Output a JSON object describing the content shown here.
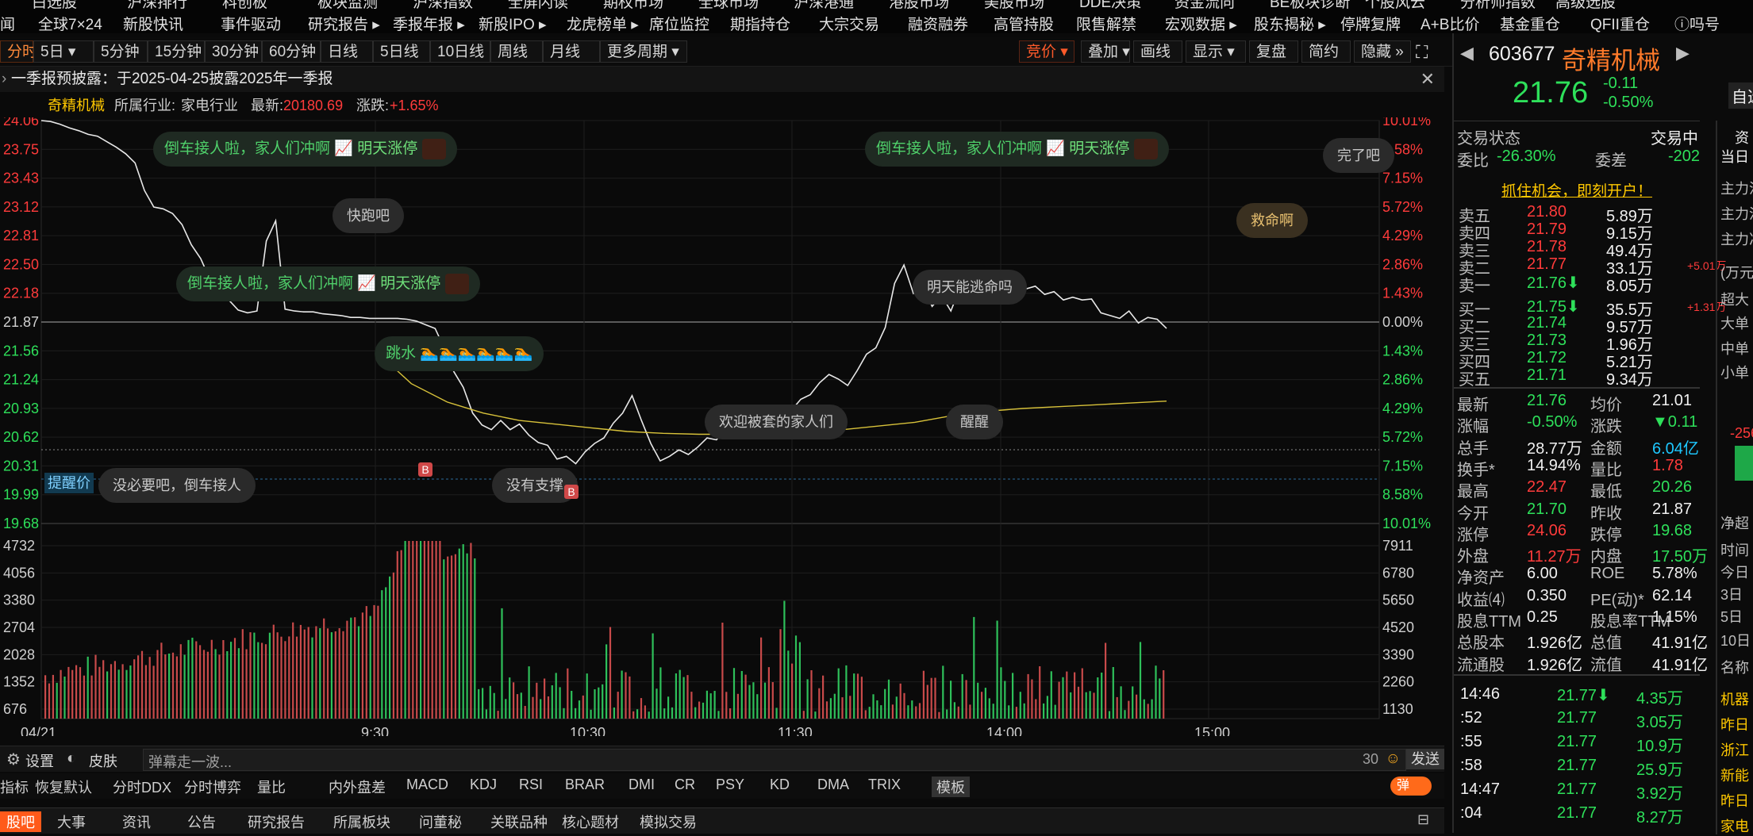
{
  "top_nav": {
    "row1_cut": [
      "白选股",
      "沪深排行",
      "科创板",
      "板块监测",
      "沪深指数",
      "全屏闪读",
      "期权市场",
      "全球市场",
      "沪深港通",
      "港股市场",
      "美股市场",
      "DDE决策",
      "资金流向",
      "BE板块诊断",
      "个股风云",
      "分析师指数",
      "高级选股"
    ],
    "row2": [
      "闻",
      "全球7×24",
      "新股快讯",
      "事件驱动",
      "研究报告 ▸",
      "季报年报 ▸",
      "新股IPO ▸",
      "龙虎榜单 ▸",
      "席位监控",
      "期指持仓",
      "大宗交易",
      "融资融券",
      "高管持股",
      "限售解禁",
      "宏观数据 ▸",
      "股东揭秘 ▸",
      "停牌复牌",
      "A+B比价",
      "基金重仓",
      "QFII重仓",
      "ⓘ吗号"
    ]
  },
  "toolbar": {
    "periods": [
      "分时",
      "5日 ▾",
      "5分钟",
      "15分钟",
      "30分钟",
      "60分钟",
      "日线",
      "5日线",
      "10日线",
      "周线",
      "月线",
      "更多周期 ▾"
    ],
    "right": [
      "竞价 ▾",
      "叠加 ▾",
      "画线",
      "显示 ▾",
      "复盘",
      "简约",
      "隐藏 »"
    ]
  },
  "notice": {
    "text": "一季报预披露：于2025-04-25披露2025年一季报"
  },
  "infobar": {
    "name": "奇精机械",
    "industry_label": "所属行业:",
    "industry": "家电行业",
    "latest_label": "最新:",
    "latest": "20180.69",
    "change_label": "涨跌:",
    "change": "+1.65%"
  },
  "chart": {
    "y_left": [
      "24.06",
      "23.75",
      "23.43",
      "23.12",
      "22.81",
      "22.50",
      "22.18",
      "21.87",
      "21.56",
      "21.24",
      "20.93",
      "20.62",
      "20.31",
      "19.99",
      "19.68"
    ],
    "y_right": [
      "10.01%",
      "8.58%",
      "7.15%",
      "5.72%",
      "4.29%",
      "2.86%",
      "1.43%",
      "0.00%",
      "1.43%",
      "2.86%",
      "4.29%",
      "5.72%",
      "7.15%",
      "8.58%",
      "10.01%"
    ],
    "vol_left": [
      "4732",
      "4056",
      "3380",
      "2704",
      "2028",
      "1352",
      "676"
    ],
    "vol_right": [
      "7911",
      "6780",
      "5650",
      "4520",
      "3390",
      "2260",
      "1130"
    ],
    "x_labels": [
      "04/21",
      "9:30",
      "10:30",
      "11:30",
      "14:00",
      "15:00"
    ],
    "price_series": [
      24.06,
      24.05,
      24.02,
      23.98,
      23.95,
      23.91,
      23.89,
      23.83,
      23.77,
      23.7,
      23.6,
      23.3,
      23.12,
      23.1,
      23.05,
      22.93,
      22.71,
      22.56,
      22.33,
      22.2,
      22.11,
      22.0,
      21.97,
      21.99,
      22.75,
      22.97,
      22.01,
      21.99,
      21.98,
      21.98,
      21.96,
      21.95,
      21.94,
      21.92,
      21.92,
      21.91,
      21.91,
      21.91,
      21.91,
      21.9,
      21.88,
      21.84,
      21.8,
      21.58,
      21.33,
      21.16,
      20.88,
      20.75,
      20.7,
      20.8,
      20.7,
      20.76,
      20.64,
      20.56,
      20.53,
      20.38,
      20.41,
      20.33,
      20.46,
      20.55,
      20.61,
      20.77,
      20.88,
      21.07,
      20.8,
      20.55,
      20.36,
      20.41,
      20.48,
      20.43,
      20.51,
      20.61,
      20.59,
      20.71,
      20.77,
      20.8,
      20.75,
      20.84,
      20.79,
      20.84,
      20.91,
      21.03,
      21.08,
      21.21,
      21.3,
      21.25,
      21.18,
      21.34,
      21.52,
      21.59,
      21.81,
      22.29,
      22.49,
      22.18,
      22.26,
      22.04,
      22.16,
      21.99,
      22.25,
      22.42,
      22.15,
      22.29,
      22.32,
      22.12,
      22.19,
      22.23,
      22.26,
      22.17,
      22.2,
      22.11,
      22.14,
      22.11,
      22.12,
      21.97,
      21.94,
      21.91,
      21.99,
      21.86,
      21.92,
      21.9,
      21.8
    ],
    "avg_series": [
      21.56,
      21.2,
      21.0,
      20.88,
      20.8,
      20.76,
      20.72,
      20.68,
      20.66,
      20.65,
      20.65,
      20.66,
      20.68,
      20.7,
      20.74,
      20.78,
      20.85,
      20.9,
      20.93,
      20.95,
      20.97,
      20.99,
      21.01
    ],
    "price_line_color": "#e8e8e8",
    "avg_line_color": "#d8c23a",
    "remind_label": "提醒价",
    "bubbles_green": [
      "倒车接人啦，家人们冲啊",
      "明天涨停",
      "倒车接人啦，家人们冲啊",
      "明天涨停",
      "倒车接人啦，家人们冲啊",
      "明天涨停",
      "跳水"
    ],
    "bubbles_gray": [
      "快跑吧",
      "没必要吧，倒车接人",
      "没有支撑",
      "欢迎被套的家人们",
      "醒醒",
      "明天能逃命吗",
      "完了吧"
    ],
    "bubble_orange": "救命啊",
    "b_marker": "B"
  },
  "bottom": {
    "settings": "设置",
    "skin": "皮肤",
    "danmu_placeholder": "弹幕走一波...",
    "danmu_count": "30",
    "send": "发送"
  },
  "indicators": [
    "指标",
    "恢复默认",
    "分时DDX",
    "分时博弈",
    "量比",
    "内外盘差",
    "MACD",
    "KDJ",
    "RSI",
    "BRAR",
    "DMI",
    "CR",
    "PSY",
    "KD",
    "DMA",
    "TRIX",
    "模板"
  ],
  "danmu_toggle": "弹",
  "tabs": [
    "股吧",
    "大事",
    "资讯",
    "公告",
    "研究报告",
    "所属板块",
    "问董秘",
    "关联品种",
    "核心题材",
    "模拟交易"
  ],
  "right": {
    "code": "603677",
    "name": "奇精机械",
    "price": "21.76",
    "chg": "-0.11",
    "chg_pct": "-0.50%",
    "self_select": "自选",
    "trade_status_label": "交易状态",
    "trade_status": "交易中",
    "weibi_label": "委比",
    "weibi": "-26.30%",
    "weicha_label": "委差",
    "weicha": "-202",
    "promo": "抓住机会，即刻开户！",
    "asks": [
      {
        "label": "卖五",
        "price": "21.80",
        "vol": "5.89万",
        "extra": ""
      },
      {
        "label": "卖四",
        "price": "21.79",
        "vol": "9.15万",
        "extra": ""
      },
      {
        "label": "卖三",
        "price": "21.78",
        "vol": "49.4万",
        "extra": ""
      },
      {
        "label": "卖二",
        "price": "21.77",
        "vol": "33.1万",
        "extra": "+5.01万"
      },
      {
        "label": "卖一",
        "price": "21.76⬇",
        "vol": "8.05万",
        "extra": ""
      }
    ],
    "bids": [
      {
        "label": "买一",
        "price": "21.75⬇",
        "vol": "35.5万",
        "extra": "+1.31万"
      },
      {
        "label": "买二",
        "price": "21.74",
        "vol": "9.57万",
        "extra": ""
      },
      {
        "label": "买三",
        "price": "21.73",
        "vol": "1.96万",
        "extra": ""
      },
      {
        "label": "买四",
        "price": "21.72",
        "vol": "5.21万",
        "extra": ""
      },
      {
        "label": "买五",
        "price": "21.71",
        "vol": "9.34万",
        "extra": ""
      }
    ],
    "stats": [
      [
        "最新",
        "21.76",
        "均价",
        "21.01"
      ],
      [
        "涨幅",
        "-0.50%",
        "涨跌",
        "▼0.11"
      ],
      [
        "总手",
        "28.77万",
        "金额",
        "6.04亿"
      ],
      [
        "换手*",
        "14.94%",
        "量比",
        "1.78"
      ],
      [
        "最高",
        "22.47",
        "最低",
        "20.26"
      ],
      [
        "今开",
        "21.70",
        "昨收",
        "21.87"
      ],
      [
        "涨停",
        "24.06",
        "跌停",
        "19.68"
      ],
      [
        "外盘",
        "11.27万",
        "内盘",
        "17.50万"
      ],
      [
        "净资产",
        "6.00",
        "ROE",
        "5.78%"
      ],
      [
        "收益⑷",
        "0.350",
        "PE(动)*",
        "62.14"
      ],
      [
        "股息TTM",
        "0.25",
        "股息率TTM",
        "1.15%"
      ],
      [
        "总股本",
        "1.926亿",
        "总值",
        "41.91亿"
      ],
      [
        "流通股",
        "1.926亿",
        "流值",
        "41.91亿"
      ]
    ],
    "ticks": [
      {
        "time": "14:46",
        "price": "21.77⬇",
        "vol": "4.35万"
      },
      {
        "time": ":52",
        "price": "21.77",
        "vol": "3.05万"
      },
      {
        "time": ":55",
        "price": "21.77",
        "vol": "10.9万"
      },
      {
        "time": ":58",
        "price": "21.77",
        "vol": "25.9万"
      },
      {
        "time": "14:47",
        "price": "21.77",
        "vol": "3.92万"
      },
      {
        "time": ":04",
        "price": "21.77",
        "vol": "8.27万"
      }
    ],
    "side_tabs": [
      "资",
      "当日"
    ],
    "side_labels": [
      "主力流",
      "主力流",
      "主力净",
      "(万元)",
      "超大",
      "大单",
      "中单",
      "小单",
      "净超",
      "时间",
      "今日",
      "3日",
      "5日",
      "10日",
      "名称",
      "机器",
      "昨日",
      "浙江",
      "新能",
      "昨日",
      "家电"
    ],
    "side_value": "-256"
  }
}
